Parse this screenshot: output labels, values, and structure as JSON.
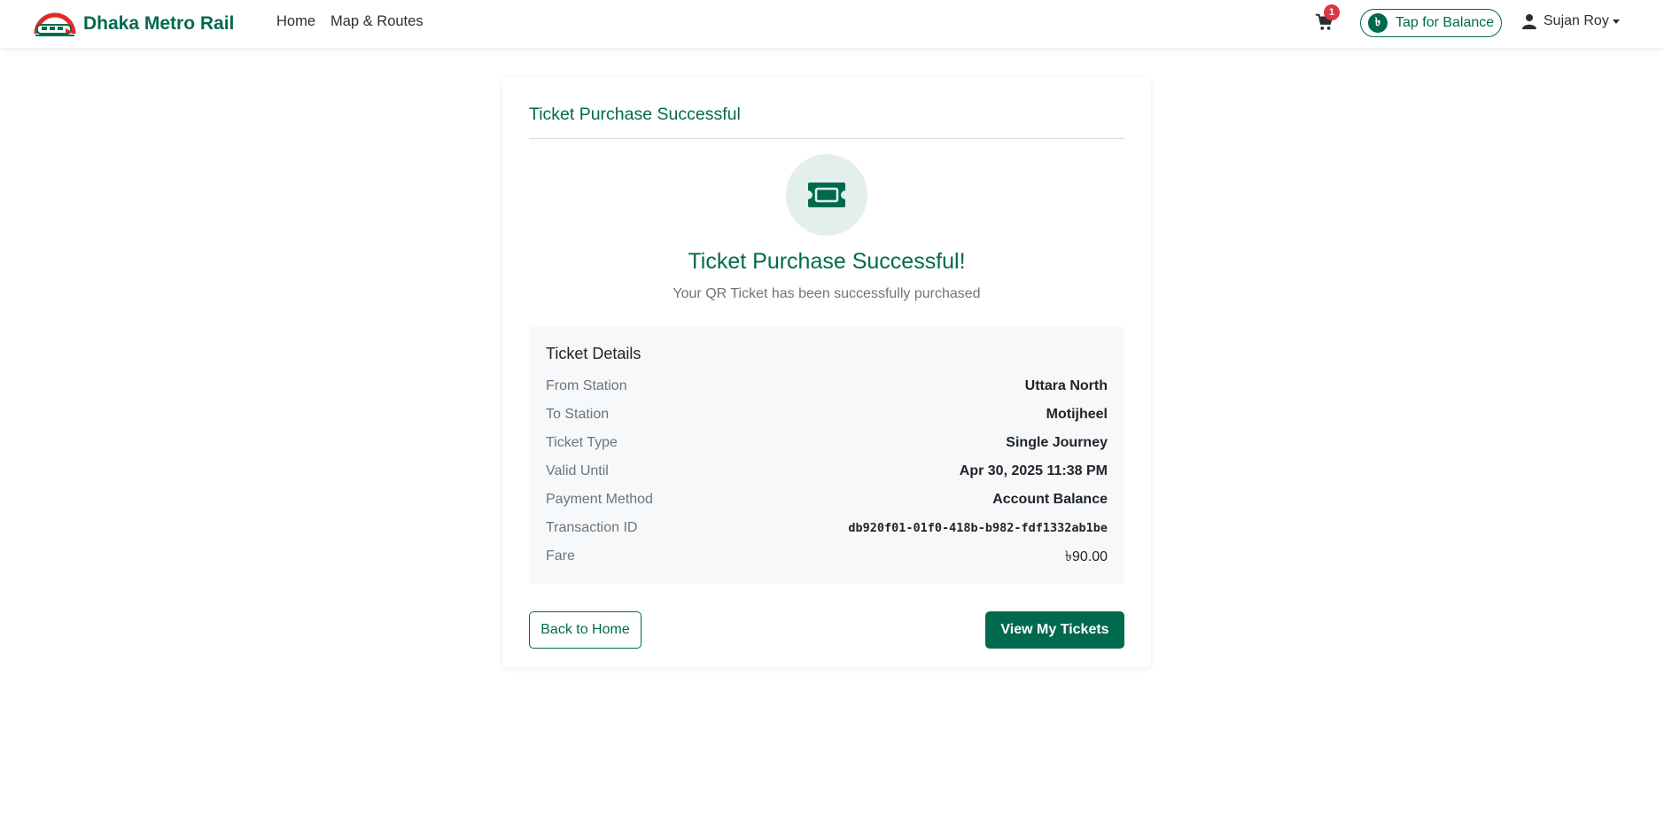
{
  "navbar": {
    "brand": "Dhaka Metro Rail",
    "links": [
      {
        "label": "Home"
      },
      {
        "label": "Map & Routes"
      }
    ],
    "cart_count": "1",
    "balance_icon": "৳",
    "balance_label": "Tap for Balance",
    "user_name": "Sujan Roy"
  },
  "card": {
    "title": "Ticket Purchase Successful",
    "icon": "ticket-icon",
    "heading": "Ticket Purchase Successful!",
    "subheading": "Your QR Ticket has been successfully purchased",
    "details": {
      "title": "Ticket Details",
      "rows": [
        {
          "label": "From Station",
          "value": "Uttara North"
        },
        {
          "label": "To Station",
          "value": "Motijheel"
        },
        {
          "label": "Ticket Type",
          "value": "Single Journey"
        },
        {
          "label": "Valid Until",
          "value": "Apr 30, 2025 11:38 PM"
        },
        {
          "label": "Payment Method",
          "value": "Account Balance"
        },
        {
          "label": "Transaction ID",
          "value": "db920f01-01f0-418b-b982-fdf1332ab1be"
        },
        {
          "label": "Fare",
          "value": "৳90.00"
        }
      ]
    },
    "back_button": "Back to Home",
    "view_button": "View My Tickets"
  },
  "colors": {
    "primary": "#006a4e",
    "badge": "#dc3545",
    "accent_red": "#e02a2a",
    "icon_bg": "#e3efeb",
    "details_bg": "#f7f8f9"
  }
}
